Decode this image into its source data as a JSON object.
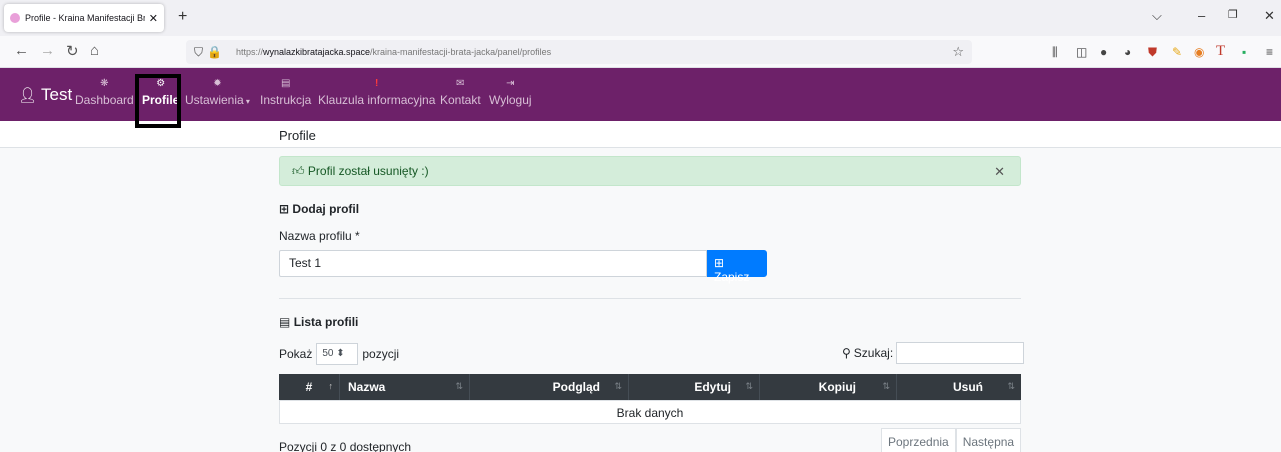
{
  "browser": {
    "tab_title": "Profile - Kraina Manifestacji Brata Jacka",
    "url_prefix": "https://",
    "url_host": "wynalazkibratajacka.space",
    "url_path": "/kraina-manifestacji-brata-jacka/panel/profiles"
  },
  "app": {
    "brand": "Test",
    "nav": [
      {
        "label": "Dashboard",
        "icon": "dashboard-icon"
      },
      {
        "label": "Profile",
        "icon": "cogs-icon"
      },
      {
        "label": "Ustawienia",
        "icon": "cog-icon"
      },
      {
        "label": "Instrukcja",
        "icon": "file-icon"
      },
      {
        "label": "Klauzula informacyjna",
        "icon": "exclamation-icon"
      },
      {
        "label": "Kontakt",
        "icon": "envelope-icon"
      },
      {
        "label": "Wyloguj",
        "icon": "sign-out-icon"
      }
    ]
  },
  "page": {
    "title": "Profile",
    "alert": "Profil został usunięty :)",
    "add_section": "Dodaj profil",
    "field_label": "Nazwa profilu *",
    "field_value": "Test 1",
    "save_label": "Zapisz",
    "list_section": "Lista profili",
    "show_label": "Pokaż",
    "show_value": "50",
    "show_suffix": "pozycji",
    "search_label": "Szukaj:",
    "columns": [
      "#",
      "Nazwa",
      "Podgląd",
      "Edytuj",
      "Kopiuj",
      "Usuń"
    ],
    "empty": "Brak danych",
    "info": "Pozycji 0 z 0 dostępnych",
    "prev": "Poprzednia",
    "next": "Następna"
  }
}
